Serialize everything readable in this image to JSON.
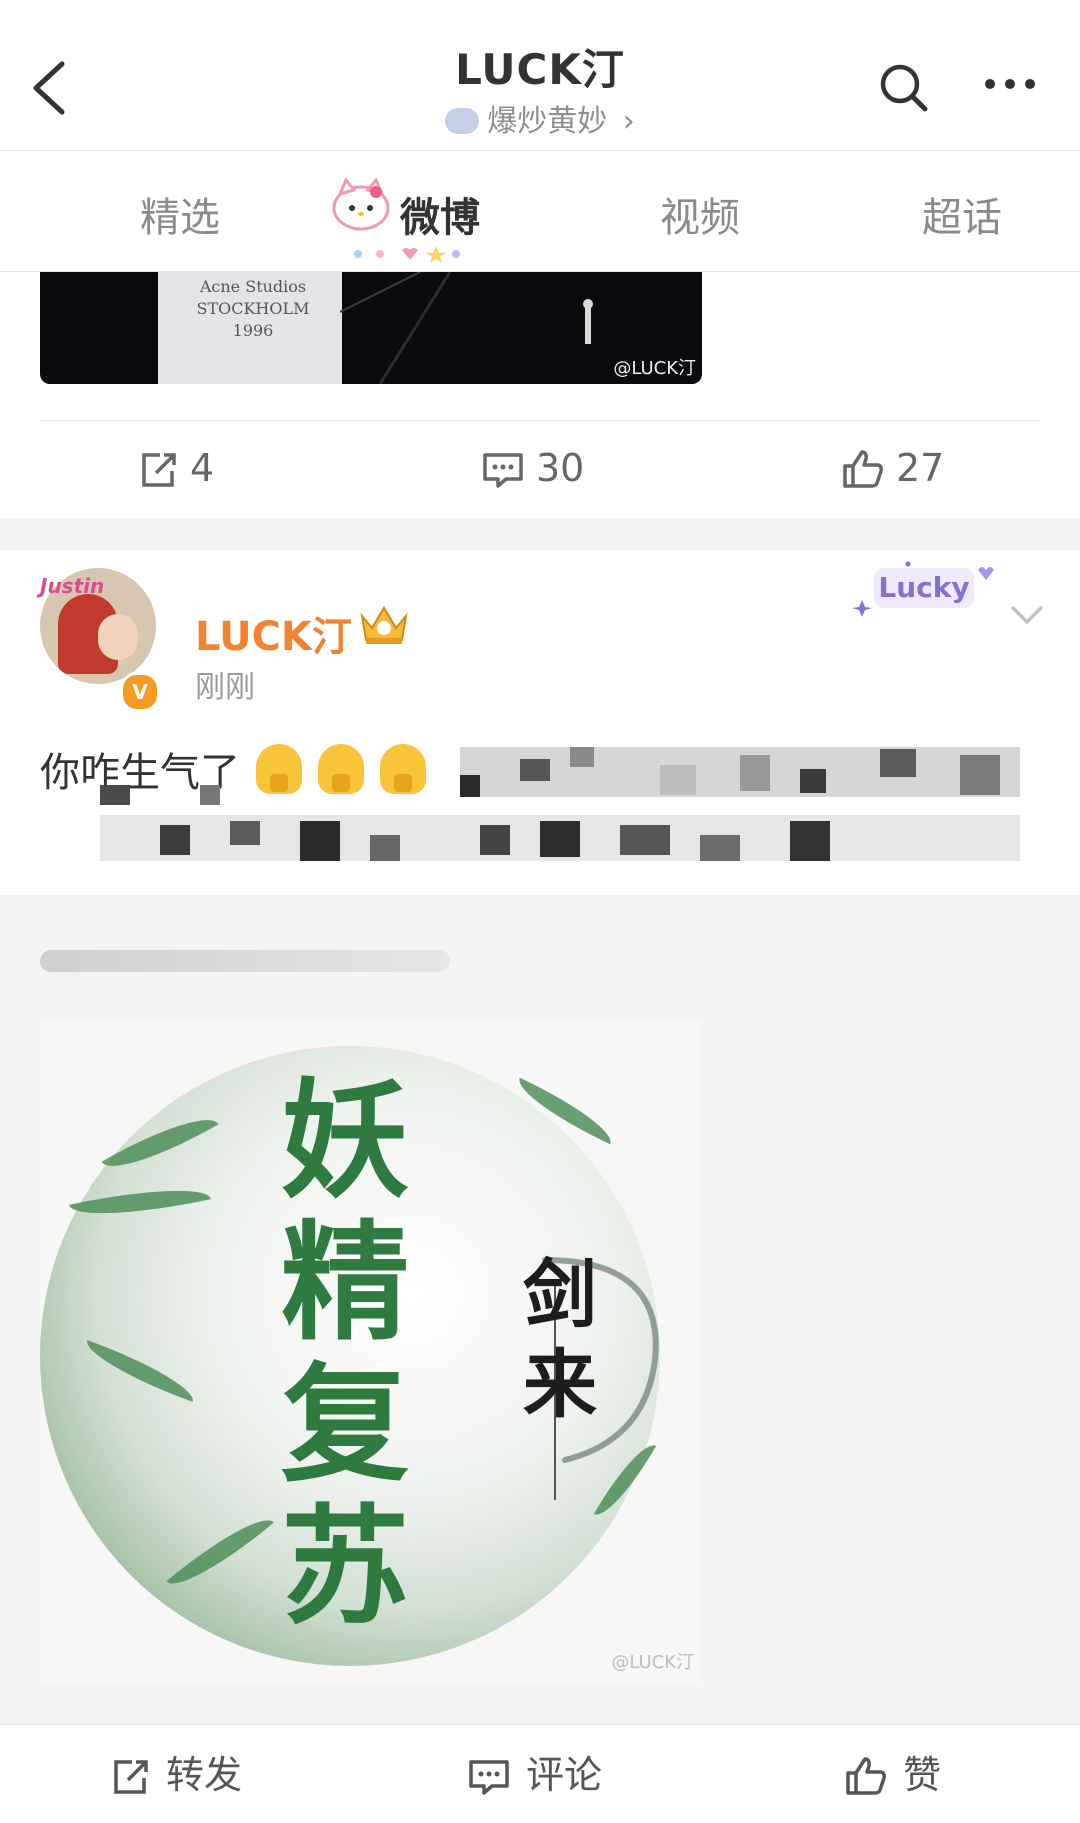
{
  "header": {
    "title": "LUCK汀",
    "subtitle": "爆炒黄妙",
    "subtitle_chevron": "›",
    "icons": [
      "back-icon",
      "search-icon",
      "more-icon"
    ]
  },
  "tabs": [
    {
      "label": "精选",
      "active": false
    },
    {
      "label": "微博",
      "active": true
    },
    {
      "label": "视频",
      "active": false
    },
    {
      "label": "超话",
      "active": false
    }
  ],
  "post1": {
    "shirt_text": "Acne Studios\nSTOCKHOLM\n1996",
    "photo_watermark": "@LUCK汀",
    "actions": {
      "repost": "4",
      "comment": "30",
      "like": "27"
    }
  },
  "post2": {
    "avatar_badge": "Justin",
    "verified_mark": "V",
    "username": "LUCK汀",
    "time": "刚刚",
    "badge": "Lucky",
    "text": "你咋生气了",
    "emoji_count_shown": 3
  },
  "quote": {
    "image_title": "妖精复苏",
    "image_subtitle": "剑来",
    "image_watermark": "@LUCK汀"
  },
  "toolbar": {
    "repost": "转发",
    "comment": "评论",
    "like": "赞"
  },
  "colors": {
    "accent_orange": "#f28331",
    "verified": "#f59a23",
    "title_green": "#2f7a3f"
  }
}
